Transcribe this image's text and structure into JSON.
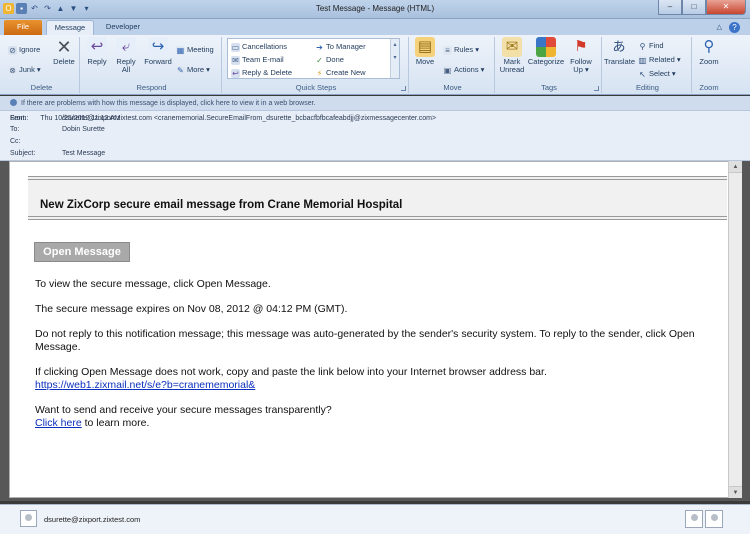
{
  "window": {
    "title": "Test Message - Message (HTML)",
    "buttons": {
      "minimize": "–",
      "maximize": "□",
      "close": "✕"
    }
  },
  "quick_access": {
    "app": "O",
    "save": "▪",
    "undo": "↶",
    "redo": "↷",
    "up": "▲",
    "down": "▼",
    "more": "▾"
  },
  "tabs": [
    "File",
    "Message",
    "Developer"
  ],
  "help_glyph": "?",
  "ribbon_min_glyph": "△",
  "ribbon": {
    "delete_group": {
      "label": "Delete",
      "ignore": "Ignore",
      "junk": "Junk ▾",
      "delete": "Delete"
    },
    "respond_group": {
      "label": "Respond",
      "reply": "Reply",
      "reply_all": "Reply All",
      "forward": "Forward",
      "meeting": "Meeting",
      "more": "More ▾"
    },
    "quick_steps": {
      "label": "Quick Steps",
      "cancellations": "Cancellations",
      "to_manager": "To Manager",
      "team_email": "Team E-mail",
      "done": "Done",
      "reply_delete": "Reply & Delete",
      "create_new": "Create New"
    },
    "move_group": {
      "label": "Move",
      "move": "Move",
      "rules": "Rules ▾",
      "actions": "Actions ▾"
    },
    "tags_group": {
      "label": "Tags",
      "mark_unread": "Mark Unread",
      "categorize": "Categorize",
      "follow_up": "Follow Up ▾"
    },
    "editing_group": {
      "label": "Editing",
      "translate": "Translate",
      "find": "Find",
      "related": "Related ▾",
      "select": "Select ▾"
    },
    "zoom_group": {
      "label": "Zoom",
      "zoom": "Zoom"
    }
  },
  "info_bar": "If there are problems with how this message is displayed, click here to view it in a web browser.",
  "headers": {
    "from_label": "From:",
    "from": "dsurette@zixport.zixtest.com <cranememorial.SecureEmailFrom_dsurette_bcbacfbfbcafeabdjj@zixmessagecenter.com>",
    "to_label": "To:",
    "to": "Dobin Surette",
    "cc_label": "Cc:",
    "cc": "",
    "subject_label": "Subject:",
    "subject": "Test Message",
    "sent_label": "Sent:",
    "sent": "Thu 10/25/2012 11:12 AM"
  },
  "message": {
    "heading": "New ZixCorp secure email message from Crane Memorial Hospital",
    "open_button": "Open Message",
    "p1": "To view the secure message, click Open Message.",
    "p2": "The secure message expires on Nov 08, 2012 @ 04:12 PM (GMT).",
    "p3": "Do not reply to this notification message; this message was auto-generated by the sender's security system. To reply to the sender, click Open Message.",
    "p4": "If clicking Open Message does not work, copy and paste the link below into your Internet browser address bar.",
    "link": "https://web1.zixmail.net/s/e?b=cranememorial&",
    "p5": "Want to send and receive your secure messages transparently?",
    "click_here": "Click here",
    "p5_tail": " to learn more."
  },
  "people_pane": {
    "email": "dsurette@zixport.zixtest.com"
  },
  "colors": {
    "ribbon": "#dfe9f5",
    "file_tab": "#e9922f",
    "link": "#0b2fbf"
  }
}
